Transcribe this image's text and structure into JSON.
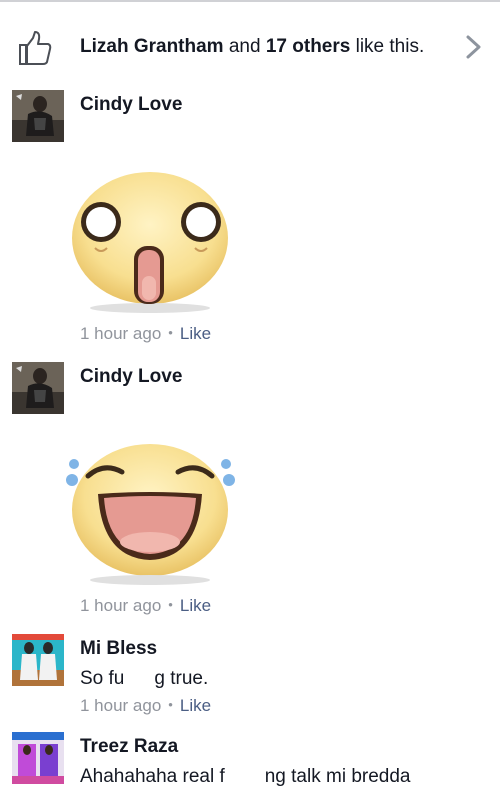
{
  "likes_bar": {
    "name": "Lizah Grantham",
    "and": "and",
    "count": "17 others",
    "suffix": "like this."
  },
  "comments": [
    {
      "name": "Cindy Love",
      "sticker": "shocked-face-sticker",
      "time": "1 hour ago",
      "action": "Like"
    },
    {
      "name": "Cindy Love",
      "sticker": "laughing-tears-sticker",
      "time": "1 hour ago",
      "action": "Like"
    },
    {
      "name": "Mi Bless",
      "text_start": "So fu",
      "text_end": "g true.",
      "time": "1 hour ago",
      "action": "Like"
    },
    {
      "name": "Treez Raza",
      "text_start": "Ahahahaha real f",
      "text_end": "ng talk mi bredda"
    }
  ],
  "colors": {
    "link": "#4b5e84",
    "meta": "#90949c",
    "text": "#141823"
  }
}
